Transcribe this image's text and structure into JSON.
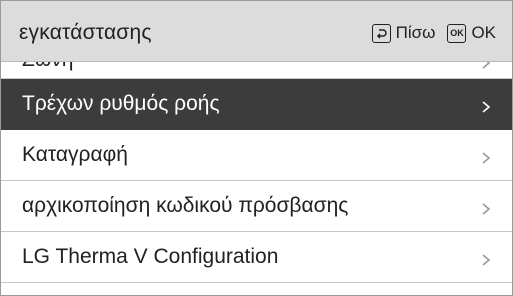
{
  "header": {
    "title": "εγκατάστασης",
    "back_label": "Πίσω",
    "ok_label": "OK",
    "ok_key_text": "OK",
    "back_icon": "back-arrow-icon",
    "ok_icon": "ok-key-icon"
  },
  "menu": {
    "items": [
      {
        "label": "Ζώνη",
        "state": "partially-scrolled"
      },
      {
        "label": "Τρέχων ρυθμός ροής",
        "state": "selected"
      },
      {
        "label": "Καταγραφή",
        "state": "normal"
      },
      {
        "label": "αρχικοποίηση κωδικού πρόσβασης",
        "state": "normal"
      },
      {
        "label": "LG Therma V Configuration",
        "state": "normal"
      }
    ]
  },
  "colors": {
    "header_bg": "#dcdcdc",
    "selected_bg": "#3c3c3c",
    "text": "#222222",
    "chevron": "#9a9a9a"
  }
}
